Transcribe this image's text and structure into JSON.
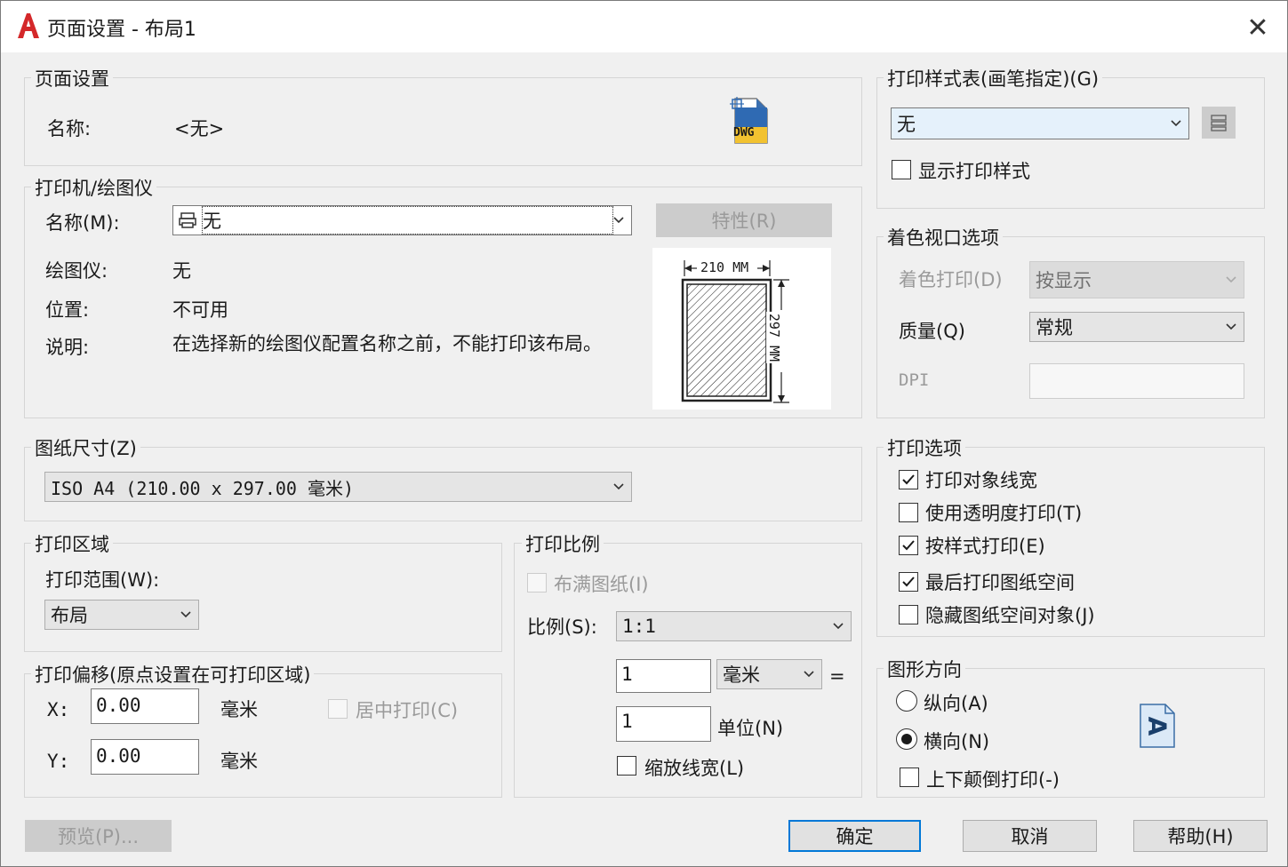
{
  "window": {
    "title": "页面设置 - 布局1",
    "close_glyph": "✕"
  },
  "page_setup": {
    "legend": "页面设置",
    "name_label": "名称:",
    "name_value": "<无>",
    "dwg_icon_text": "DWG"
  },
  "printer": {
    "legend": "打印机/绘图仪",
    "name_label": "名称(M):",
    "name_value": "无",
    "properties_button": "特性(R)",
    "plotter_label": "绘图仪:",
    "plotter_value": "无",
    "location_label": "位置:",
    "location_value": "不可用",
    "desc_label": "说明:",
    "desc_value": "在选择新的绘图仪配置名称之前，不能打印该布局。",
    "preview": {
      "width_text": "210 MM",
      "height_text": "297 MM"
    }
  },
  "paper_size": {
    "legend": "图纸尺寸(Z)",
    "value": "ISO A4 (210.00 x 297.00 毫米)"
  },
  "plot_area": {
    "legend": "打印区域",
    "range_label": "打印范围(W):",
    "range_value": "布局"
  },
  "plot_offset": {
    "legend": "打印偏移(原点设置在可打印区域)",
    "x_label": "X:",
    "x_value": "0.00",
    "x_unit": "毫米",
    "y_label": "Y:",
    "y_value": "0.00",
    "y_unit": "毫米",
    "center_label": "居中打印(C)"
  },
  "plot_scale": {
    "legend": "打印比例",
    "fit_label": "布满图纸(I)",
    "scale_label": "比例(S):",
    "scale_value": "1:1",
    "mm_value": "1",
    "mm_unit": "毫米",
    "equals": "=",
    "unit_value": "1",
    "unit_label": "单位(N)",
    "lineweight_label": "缩放线宽(L)"
  },
  "plot_style_table": {
    "legend": "打印样式表(画笔指定)(G)",
    "value": "无",
    "display_label": "显示打印样式"
  },
  "shaded_viewport": {
    "legend": "着色视口选项",
    "shade_label": "着色打印(D)",
    "shade_value": "按显示",
    "quality_label": "质量(Q)",
    "quality_value": "常规",
    "dpi_label": "DPI"
  },
  "plot_options": {
    "legend": "打印选项",
    "items": [
      {
        "label": "打印对象线宽",
        "checked": true
      },
      {
        "label": "使用透明度打印(T)",
        "checked": false
      },
      {
        "label": "按样式打印(E)",
        "checked": true
      },
      {
        "label": "最后打印图纸空间",
        "checked": true
      },
      {
        "label": "隐藏图纸空间对象(J)",
        "checked": false
      }
    ]
  },
  "orientation": {
    "legend": "图形方向",
    "portrait_label": "纵向(A)",
    "landscape_label": "横向(N)",
    "upside_down_label": "上下颠倒打印(-)",
    "icon_letter": "A"
  },
  "footer": {
    "preview_button": "预览(P)...",
    "ok_button": "确定",
    "cancel_button": "取消",
    "help_button": "帮助(H)"
  },
  "colors": {
    "accent": "#0078d7",
    "autocad_red": "#d4282a"
  }
}
